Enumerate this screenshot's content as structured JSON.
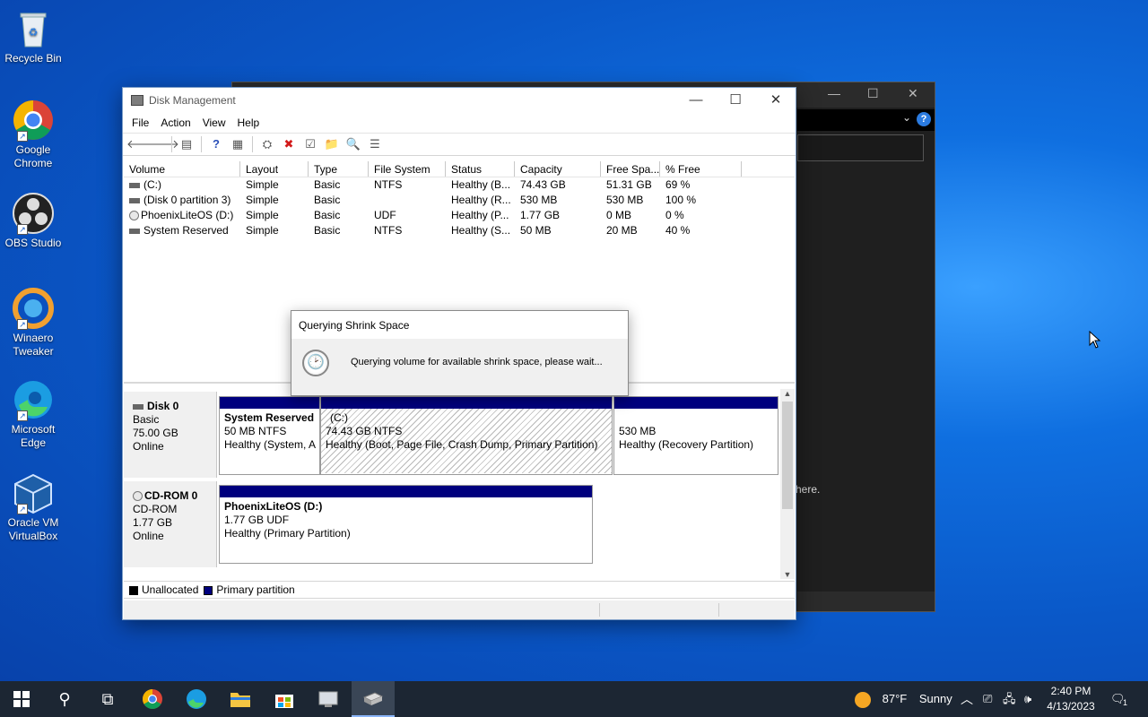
{
  "desktop": {
    "icons": [
      {
        "label": "Recycle Bin",
        "icon": "recycle-bin-icon"
      },
      {
        "label": "Google Chrome",
        "icon": "chrome-icon"
      },
      {
        "label": "OBS Studio",
        "icon": "obs-icon"
      },
      {
        "label": "Winaero Tweaker",
        "icon": "winaero-icon"
      },
      {
        "label": "Microsoft Edge",
        "icon": "edge-icon"
      },
      {
        "label": "Oracle VM VirtualBox",
        "icon": "virtualbox-icon"
      }
    ]
  },
  "background_window": {
    "text": "here."
  },
  "window": {
    "title": "Disk Management",
    "menu": [
      "File",
      "Action",
      "View",
      "Help"
    ],
    "columns": [
      "Volume",
      "Layout",
      "Type",
      "File System",
      "Status",
      "Capacity",
      "Free Spa...",
      "% Free"
    ],
    "rows": [
      {
        "volume": "(C:)",
        "layout": "Simple",
        "type": "Basic",
        "fs": "NTFS",
        "status": "Healthy (B...",
        "capacity": "74.43 GB",
        "free": "51.31 GB",
        "pct": "69 %"
      },
      {
        "volume": "(Disk 0 partition 3)",
        "layout": "Simple",
        "type": "Basic",
        "fs": "",
        "status": "Healthy (R...",
        "capacity": "530 MB",
        "free": "530 MB",
        "pct": "100 %"
      },
      {
        "volume": "PhoenixLiteOS (D:)",
        "layout": "Simple",
        "type": "Basic",
        "fs": "UDF",
        "status": "Healthy (P...",
        "capacity": "1.77 GB",
        "free": "0 MB",
        "pct": "0 %"
      },
      {
        "volume": "System Reserved",
        "layout": "Simple",
        "type": "Basic",
        "fs": "NTFS",
        "status": "Healthy (S...",
        "capacity": "50 MB",
        "free": "20 MB",
        "pct": "40 %"
      }
    ],
    "disks": [
      {
        "name": "Disk 0",
        "type": "Basic",
        "size": "75.00 GB",
        "state": "Online",
        "partitions": [
          {
            "name": "System Reserved",
            "info": "50 MB NTFS",
            "status": "Healthy (System, A"
          },
          {
            "name": "(C:)",
            "info": "74.43 GB NTFS",
            "status": "Healthy (Boot, Page File, Crash Dump, Primary Partition)"
          },
          {
            "name": "",
            "info": "530 MB",
            "status": "Healthy (Recovery Partition)"
          }
        ]
      },
      {
        "name": "CD-ROM 0",
        "type": "CD-ROM",
        "size": "1.77 GB",
        "state": "Online",
        "partitions": [
          {
            "name": "PhoenixLiteOS  (D:)",
            "info": "1.77 GB UDF",
            "status": "Healthy (Primary Partition)"
          }
        ]
      }
    ],
    "legend": {
      "unallocated": "Unallocated",
      "primary": "Primary partition",
      "unallocated_color": "#000000",
      "primary_color": "#00007e"
    }
  },
  "dialog": {
    "title": "Querying Shrink Space",
    "message": "Querying volume for available shrink space, please wait..."
  },
  "taskbar": {
    "weather_temp": "87°F",
    "weather_text": "Sunny",
    "time": "2:40 PM",
    "date": "4/13/2023",
    "notification_count": "1"
  }
}
